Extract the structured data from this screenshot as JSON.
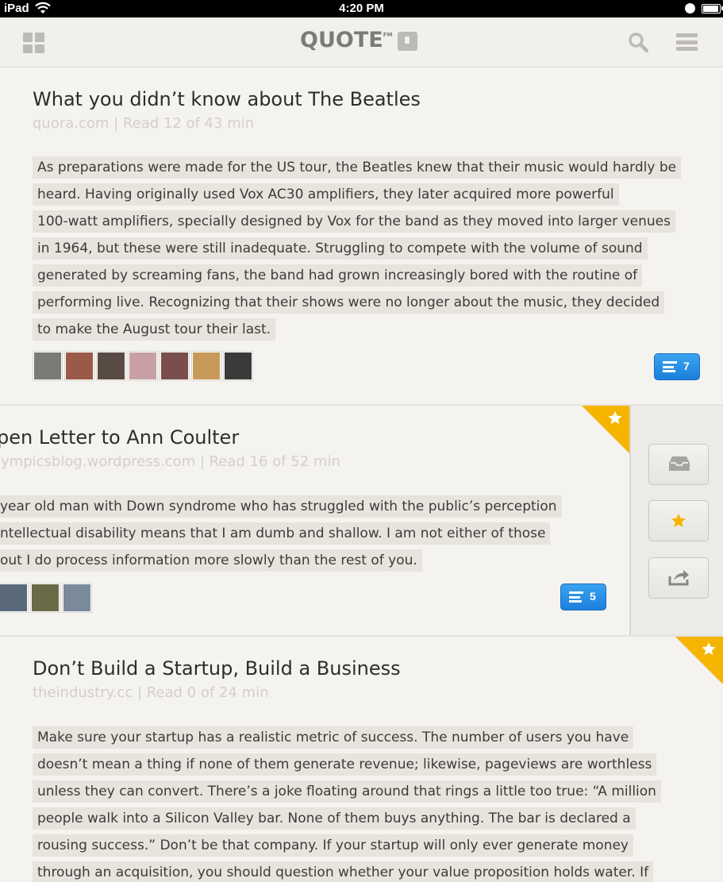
{
  "status_bar": {
    "carrier": "iPad",
    "time": "4:20 PM"
  },
  "header": {
    "logo_text": "QUOTE",
    "logo_superscript": "FM"
  },
  "articles": [
    {
      "title": "What you didn’t know about The Beatles",
      "meta": "quora.com | Read 12 of 43 min",
      "excerpt_lines": [
        "As preparations were made for the US tour, the Beatles knew that their music would hardly be",
        "heard. Having originally used Vox AC30 amplifiers, they later acquired more powerful",
        "100-watt amplifiers, specially designed by Vox for the band as they moved into larger venues",
        "in 1964, but these were still inadequate. Struggling to compete with the volume of sound",
        "generated by screaming fans, the band had grown increasingly bored with the routine of",
        "performing live. Recognizing that their shows were no longer about the music, they decided",
        "to make the August tour their last."
      ],
      "avatar_colors": [
        "#7a7a78",
        "#9a5a48",
        "#5a4a44",
        "#c8a0a4",
        "#7a4e4a",
        "#c89a5a",
        "#3a3a3a"
      ],
      "comment_count": "7",
      "starred": false
    },
    {
      "title": "pen Letter to Ann Coulter",
      "meta": "lympicsblog.wordpress.com | Read 16 of 52 min",
      "excerpt_lines": [
        "year old man with Down syndrome who has struggled with the public’s perception",
        "ntellectual disability means that I am dumb and shallow.  I am not either of those",
        "out I do process information more slowly than the rest of you."
      ],
      "avatar_colors": [
        "#5a6a7a",
        "#6a6a48",
        "#7a8a9a"
      ],
      "comment_count": "5",
      "starred": true
    },
    {
      "title": "Don’t Build a Startup, Build a Business",
      "meta": "theindustry.cc | Read 0 of 24 min",
      "excerpt_lines": [
        "Make sure your startup has a realistic metric of success. The number of users you have",
        "doesn’t mean a thing if none of them generate revenue; likewise, pageviews are worthless",
        "unless they can convert. There’s a joke floating around that rings a little too true: “A million",
        "people walk into a Silicon Valley bar. None of them buys anything. The bar is declared a",
        "rousing success.” Don’t be that company. If your startup will only ever generate money",
        "through an acquisition, you should question whether your value proposition holds water. If"
      ],
      "starred": true
    }
  ],
  "colors": {
    "accent_blue": "#2a8fe6",
    "star_gold": "#f5b400",
    "highlight": "#e6e4dc",
    "meta_gray": "#d3d0c8"
  }
}
